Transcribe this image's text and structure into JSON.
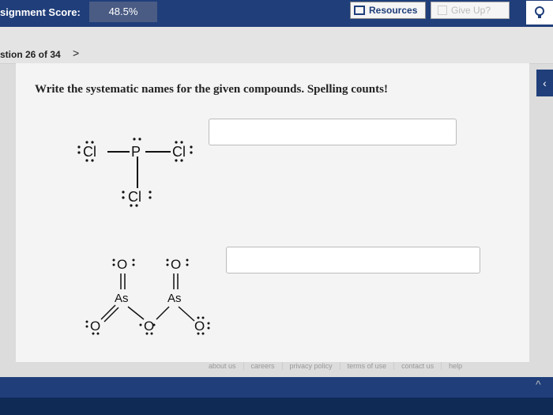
{
  "topbar": {
    "score_label": "signment Score:",
    "score_value": "48.5%",
    "resources_label": "Resources",
    "giveup_label": "Give Up?"
  },
  "nav": {
    "question_label": "stion 26 of 34",
    "next_symbol": ">"
  },
  "question": {
    "prompt": "Write the systematic names for the given compounds. Spelling counts!"
  },
  "structure1": {
    "atoms": [
      "Cl",
      "P",
      "Cl",
      "Cl"
    ]
  },
  "structure2": {
    "atoms": [
      "O",
      "O",
      "As",
      "As",
      "O",
      "O",
      "O"
    ]
  },
  "answers": [
    {
      "value": ""
    },
    {
      "value": ""
    }
  ],
  "footer": {
    "links": [
      "about us",
      "careers",
      "privacy policy",
      "terms of use",
      "contact us",
      "help"
    ]
  },
  "icons": {
    "lightbulb": "lightbulb-icon",
    "resources": "resources-icon",
    "giveup": "giveup-icon",
    "side_tab": "chevron-left-icon",
    "scroll": "chevron-up-icon"
  }
}
